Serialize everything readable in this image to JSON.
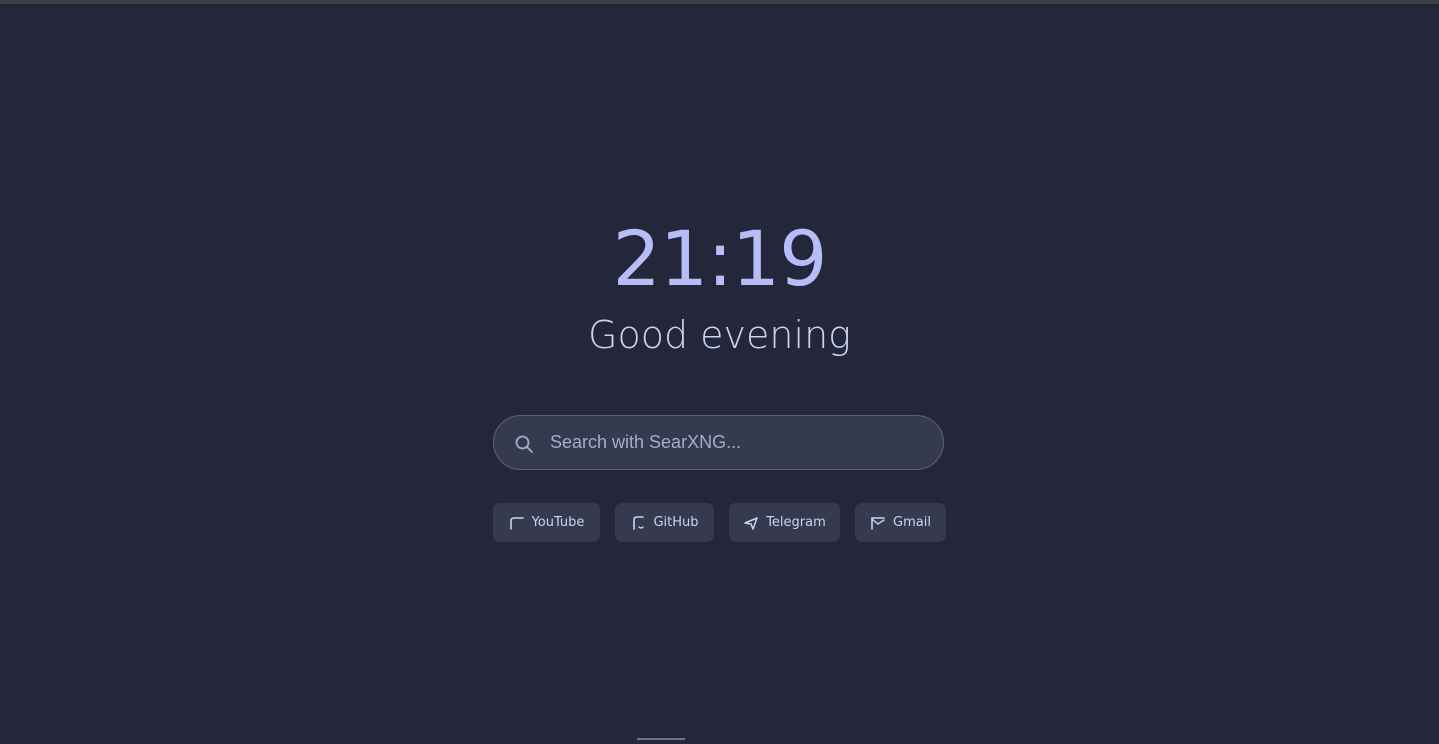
{
  "clock": {
    "time": "21:19"
  },
  "greeting": {
    "text": "Good evening"
  },
  "search": {
    "placeholder": "Search with SearXNG...",
    "value": ""
  },
  "shortcuts": [
    {
      "label": "YouTube",
      "icon": "youtube-icon"
    },
    {
      "label": "GitHub",
      "icon": "github-icon"
    },
    {
      "label": "Telegram",
      "icon": "telegram-icon"
    },
    {
      "label": "Gmail",
      "icon": "gmail-icon"
    }
  ],
  "colors": {
    "background": "#24273a",
    "accent": "#b7bdf8",
    "text": "#cad3f5",
    "surface": "#363a4f"
  }
}
